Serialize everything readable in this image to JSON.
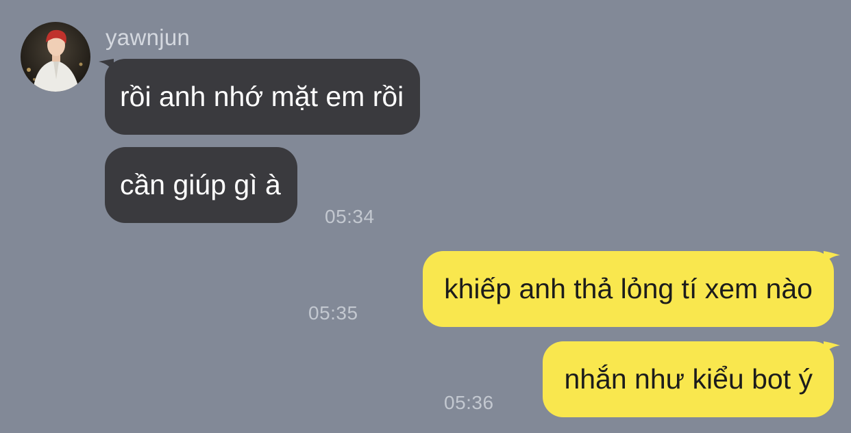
{
  "colors": {
    "background": "#828997",
    "incoming_bubble": "#3a3a3e",
    "outgoing_bubble": "#f9e74e",
    "incoming_text": "#ffffff",
    "outgoing_text": "#1c1c1c",
    "timestamp": "#c3c8d0",
    "sender_name": "#d4d8df"
  },
  "chat": {
    "sender": {
      "name": "yawnjun",
      "avatar_icon": "profile-photo"
    },
    "messages": [
      {
        "direction": "incoming",
        "text": "rồi anh nhớ mặt em rồi"
      },
      {
        "direction": "incoming",
        "text": "cần giúp gì à",
        "time": "05:34"
      },
      {
        "direction": "outgoing",
        "text": "khiếp anh thả lỏng tí xem nào",
        "time": "05:35"
      },
      {
        "direction": "outgoing",
        "text": "nhắn như kiểu bot ý",
        "time": "05:36"
      }
    ]
  }
}
